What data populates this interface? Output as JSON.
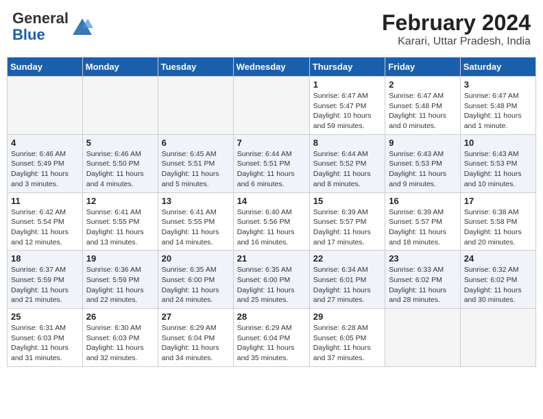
{
  "header": {
    "logo_general": "General",
    "logo_blue": "Blue",
    "month_year": "February 2024",
    "location": "Karari, Uttar Pradesh, India"
  },
  "days_of_week": [
    "Sunday",
    "Monday",
    "Tuesday",
    "Wednesday",
    "Thursday",
    "Friday",
    "Saturday"
  ],
  "weeks": [
    [
      {
        "num": "",
        "info": ""
      },
      {
        "num": "",
        "info": ""
      },
      {
        "num": "",
        "info": ""
      },
      {
        "num": "",
        "info": ""
      },
      {
        "num": "1",
        "info": "Sunrise: 6:47 AM\nSunset: 5:47 PM\nDaylight: 10 hours and 59 minutes."
      },
      {
        "num": "2",
        "info": "Sunrise: 6:47 AM\nSunset: 5:48 PM\nDaylight: 11 hours and 0 minutes."
      },
      {
        "num": "3",
        "info": "Sunrise: 6:47 AM\nSunset: 5:48 PM\nDaylight: 11 hours and 1 minute."
      }
    ],
    [
      {
        "num": "4",
        "info": "Sunrise: 6:46 AM\nSunset: 5:49 PM\nDaylight: 11 hours and 3 minutes."
      },
      {
        "num": "5",
        "info": "Sunrise: 6:46 AM\nSunset: 5:50 PM\nDaylight: 11 hours and 4 minutes."
      },
      {
        "num": "6",
        "info": "Sunrise: 6:45 AM\nSunset: 5:51 PM\nDaylight: 11 hours and 5 minutes."
      },
      {
        "num": "7",
        "info": "Sunrise: 6:44 AM\nSunset: 5:51 PM\nDaylight: 11 hours and 6 minutes."
      },
      {
        "num": "8",
        "info": "Sunrise: 6:44 AM\nSunset: 5:52 PM\nDaylight: 11 hours and 8 minutes."
      },
      {
        "num": "9",
        "info": "Sunrise: 6:43 AM\nSunset: 5:53 PM\nDaylight: 11 hours and 9 minutes."
      },
      {
        "num": "10",
        "info": "Sunrise: 6:43 AM\nSunset: 5:53 PM\nDaylight: 11 hours and 10 minutes."
      }
    ],
    [
      {
        "num": "11",
        "info": "Sunrise: 6:42 AM\nSunset: 5:54 PM\nDaylight: 11 hours and 12 minutes."
      },
      {
        "num": "12",
        "info": "Sunrise: 6:41 AM\nSunset: 5:55 PM\nDaylight: 11 hours and 13 minutes."
      },
      {
        "num": "13",
        "info": "Sunrise: 6:41 AM\nSunset: 5:55 PM\nDaylight: 11 hours and 14 minutes."
      },
      {
        "num": "14",
        "info": "Sunrise: 6:40 AM\nSunset: 5:56 PM\nDaylight: 11 hours and 16 minutes."
      },
      {
        "num": "15",
        "info": "Sunrise: 6:39 AM\nSunset: 5:57 PM\nDaylight: 11 hours and 17 minutes."
      },
      {
        "num": "16",
        "info": "Sunrise: 6:39 AM\nSunset: 5:57 PM\nDaylight: 11 hours and 18 minutes."
      },
      {
        "num": "17",
        "info": "Sunrise: 6:38 AM\nSunset: 5:58 PM\nDaylight: 11 hours and 20 minutes."
      }
    ],
    [
      {
        "num": "18",
        "info": "Sunrise: 6:37 AM\nSunset: 5:59 PM\nDaylight: 11 hours and 21 minutes."
      },
      {
        "num": "19",
        "info": "Sunrise: 6:36 AM\nSunset: 5:59 PM\nDaylight: 11 hours and 22 minutes."
      },
      {
        "num": "20",
        "info": "Sunrise: 6:35 AM\nSunset: 6:00 PM\nDaylight: 11 hours and 24 minutes."
      },
      {
        "num": "21",
        "info": "Sunrise: 6:35 AM\nSunset: 6:00 PM\nDaylight: 11 hours and 25 minutes."
      },
      {
        "num": "22",
        "info": "Sunrise: 6:34 AM\nSunset: 6:01 PM\nDaylight: 11 hours and 27 minutes."
      },
      {
        "num": "23",
        "info": "Sunrise: 6:33 AM\nSunset: 6:02 PM\nDaylight: 11 hours and 28 minutes."
      },
      {
        "num": "24",
        "info": "Sunrise: 6:32 AM\nSunset: 6:02 PM\nDaylight: 11 hours and 30 minutes."
      }
    ],
    [
      {
        "num": "25",
        "info": "Sunrise: 6:31 AM\nSunset: 6:03 PM\nDaylight: 11 hours and 31 minutes."
      },
      {
        "num": "26",
        "info": "Sunrise: 6:30 AM\nSunset: 6:03 PM\nDaylight: 11 hours and 32 minutes."
      },
      {
        "num": "27",
        "info": "Sunrise: 6:29 AM\nSunset: 6:04 PM\nDaylight: 11 hours and 34 minutes."
      },
      {
        "num": "28",
        "info": "Sunrise: 6:29 AM\nSunset: 6:04 PM\nDaylight: 11 hours and 35 minutes."
      },
      {
        "num": "29",
        "info": "Sunrise: 6:28 AM\nSunset: 6:05 PM\nDaylight: 11 hours and 37 minutes."
      },
      {
        "num": "",
        "info": ""
      },
      {
        "num": "",
        "info": ""
      }
    ]
  ]
}
